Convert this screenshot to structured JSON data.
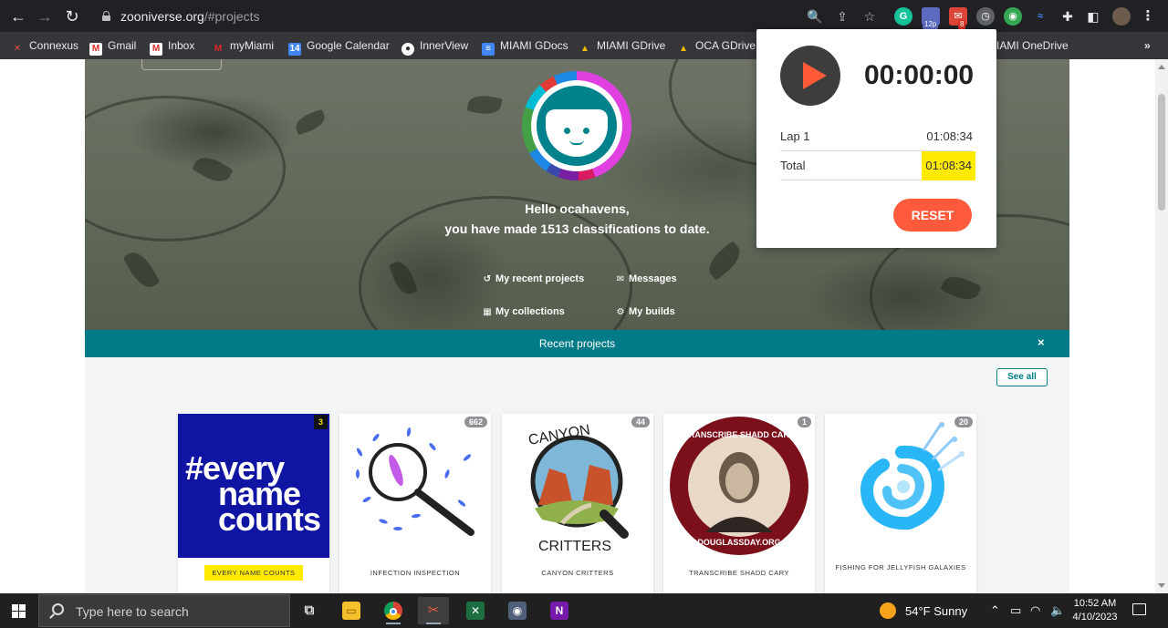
{
  "browser": {
    "url_host": "zooniverse.org",
    "url_path": "/#projects",
    "bookmarks": [
      "Connexus",
      "Gmail",
      "Inbox",
      "myMiami",
      "Google Calendar",
      "InnerView",
      "MIAMI GDocs",
      "MIAMI GDrive",
      "OCA GDrive",
      "IAMI OneDrive"
    ],
    "ext_badge_1": "12p",
    "ext_badge_2": "8",
    "more_bookmarks": "»"
  },
  "hero": {
    "greeting_line1": "Hello ocahavens,",
    "greeting_line2": "you have made 1513 classifications to date.",
    "links": {
      "recent_projects": "My recent projects",
      "messages": "Messages",
      "collections": "My collections",
      "builds": "My builds"
    }
  },
  "recent": {
    "title": "Recent projects",
    "close": "×",
    "see_all": "See all",
    "projects": [
      {
        "name": "EVERY NAME COUNTS",
        "count": "3",
        "logo_line1": "#every",
        "logo_line2": "name",
        "logo_line3": "counts"
      },
      {
        "name": "INFECTION INSPECTION",
        "count": "662"
      },
      {
        "name": "CANYON CRITTERS",
        "count": "44",
        "logo_top": "CANYON",
        "logo_bottom": "CRITTERS"
      },
      {
        "name": "TRANSCRIBE SHADD CARY",
        "count": "1",
        "logo_top": "TRANSCRIBE SHADD CARY",
        "logo_bottom": "DOUGLASSDAY.ORG"
      },
      {
        "name": "FISHING FOR JELLYFISH GALAXIES",
        "count": "20"
      }
    ]
  },
  "timer": {
    "display": "00:00:00",
    "laps": [
      {
        "label": "Lap 1",
        "value": "01:08:34"
      },
      {
        "label": "Total",
        "value": "01:08:34"
      }
    ],
    "reset_label": "RESET"
  },
  "taskbar": {
    "search_placeholder": "Type here to search",
    "weather": "54°F  Sunny",
    "time": "10:52 AM",
    "date": "4/10/2023"
  },
  "colors": {
    "accent_teal": "#007b87",
    "timer_orange": "#ff5a3c",
    "highlight": "#ffea00",
    "enc_blue": "#0f14a3"
  }
}
